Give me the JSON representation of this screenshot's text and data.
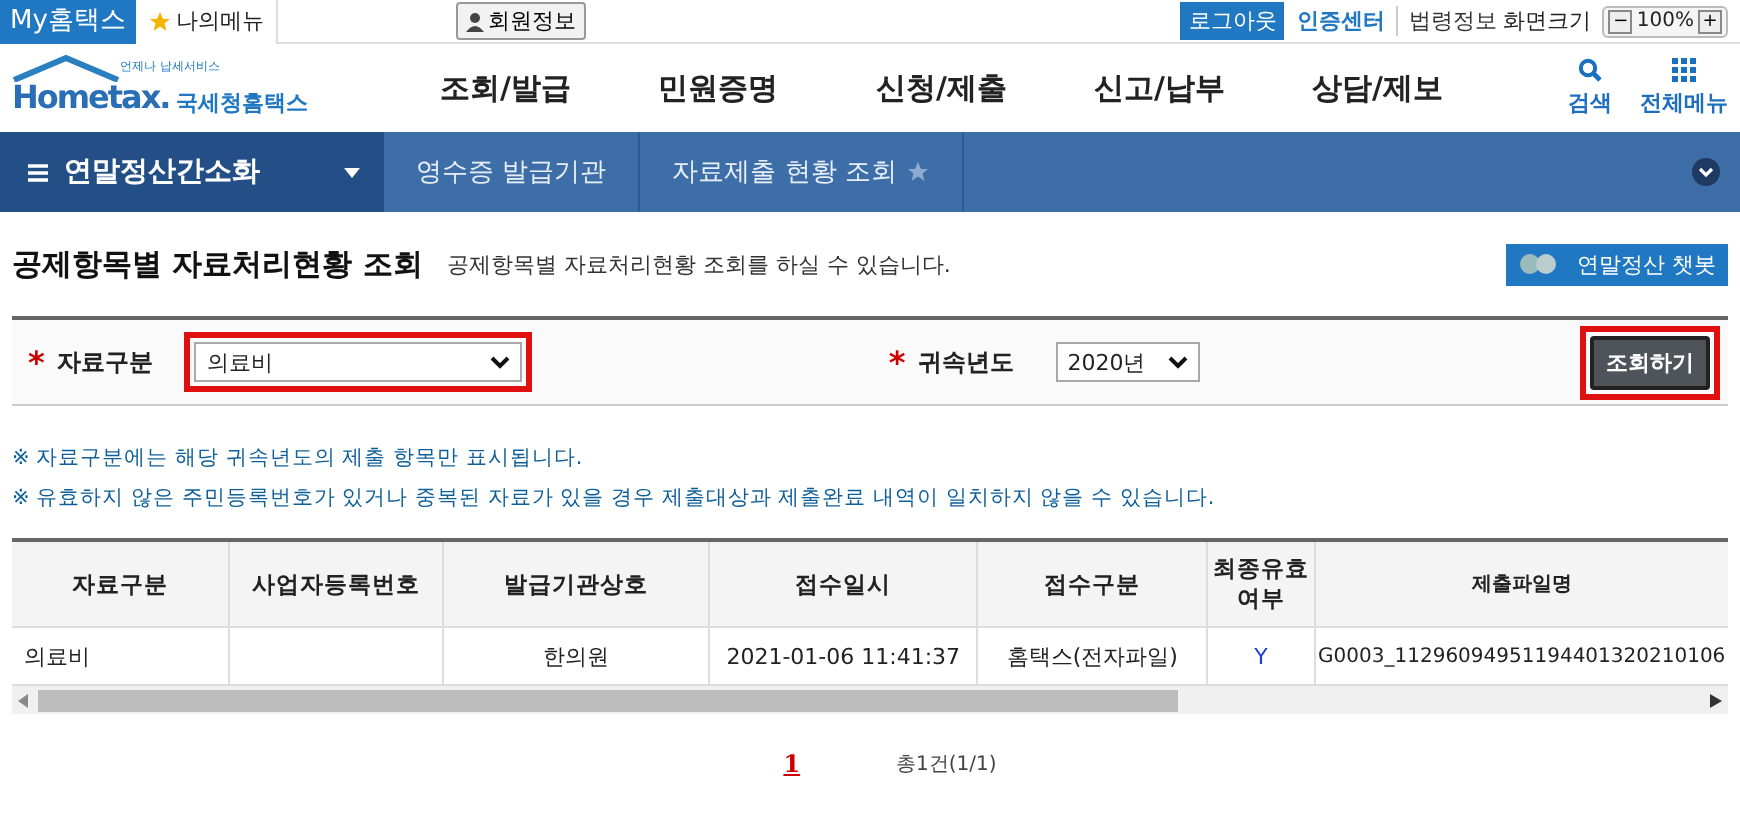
{
  "top_bar": {
    "my_hometax": "My홈택스",
    "my_menu": "나의메뉴",
    "member_info": "회원정보",
    "logout": "로그아웃",
    "cert_center": "인증센터",
    "law_info": "법령정보",
    "zoom_label": "화면크기",
    "zoom_minus": "−",
    "zoom_value": "100%",
    "zoom_plus": "+"
  },
  "header": {
    "logo_small": "언제나 납세서비스",
    "logo_main": "Hometax.",
    "logo_sub": "국세청홈택스",
    "menu": [
      "조회/발급",
      "민원증명",
      "신청/제출",
      "신고/납부",
      "상담/제보"
    ],
    "search": "검색",
    "all_menu": "전체메뉴"
  },
  "breadcrumb": {
    "section": "연말정산간소화",
    "items": [
      "영수증 발급기관",
      "자료제출 현황 조회"
    ]
  },
  "page": {
    "title": "공제항목별 자료처리현황 조회",
    "subtitle": "공제항목별 자료처리현황 조회를 하실 수 있습니다.",
    "chatbot": "연말정산 챗봇"
  },
  "filters": [
    {
      "required_mark": "*",
      "label": "자료구분",
      "value": "의료비",
      "highlighted": true
    },
    {
      "required_mark": "*",
      "label": "귀속년도",
      "value": "2020년",
      "highlighted": false
    }
  ],
  "search_button": {
    "label": "조회하기",
    "highlighted": true
  },
  "notes": [
    "※ 자료구분에는 해당 귀속년도의 제출 항목만 표시됩니다.",
    "※ 유효하지 않은 주민등록번호가 있거나 중복된 자료가 있을 경우 제출대상과 제출완료 내역이 일치하지 않을 수 있습니다."
  ],
  "table": {
    "columns": [
      "자료구분",
      "사업자등록번호",
      "발급기관상호",
      "접수일시",
      "접수구분",
      "최종유효 여부",
      "제출파일명"
    ],
    "rows": [
      [
        "의료비",
        "",
        "한의원",
        "2021-01-06 11:41:37",
        "홈택스(전자파일)",
        "Y",
        "G0003_11296094951194401320210106"
      ]
    ]
  },
  "pager": {
    "pages": [
      {
        "label": "1",
        "selected": true
      }
    ],
    "total": "총1건(1/1)"
  }
}
